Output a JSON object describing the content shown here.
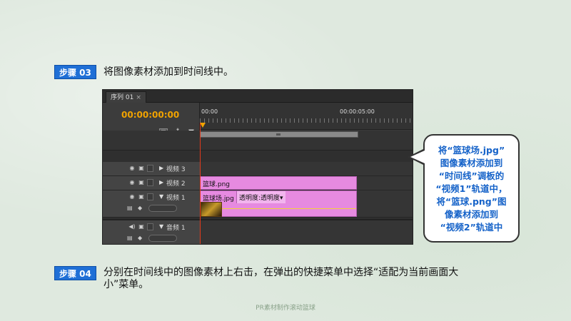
{
  "step3": {
    "badge": "步骤 03",
    "text": "将图像素材添加到时间线中。"
  },
  "step4": {
    "badge": "步骤 04",
    "text_line1": "分别在时间线中的图像素材上右击，在弹出的快捷菜单中选择“适配为当前画面大",
    "text_line2": "小”菜单。"
  },
  "premiere": {
    "tab_label": "序列 01",
    "tab_close": "×",
    "timecode": "00:00:00:00",
    "ruler_start": "00:00",
    "ruler_mid": "00:00:05:00",
    "tracks": [
      {
        "name": "视频 3"
      },
      {
        "name": "视频 2",
        "clip": "篮球.png"
      },
      {
        "name": "视频 1",
        "clip": "篮球场.jpg",
        "opacity_label": "透明度:透明度▾"
      },
      {
        "name": "音频 1"
      }
    ]
  },
  "callout": {
    "lines": [
      "将“篮球场.jpg”",
      "图像素材添加到",
      "“时间线”调板的",
      "“视频1”轨道中，",
      "将“篮球.png”图",
      "像素材添加到",
      "“视频2”轨道中"
    ]
  },
  "footer": "PR素材制作滚动篮球",
  "colors": {
    "accent_blue": "#1f6fd6",
    "clip_pink": "#e68ae0",
    "timecode_orange": "#f1a300",
    "playhead_red": "#e03a1c"
  }
}
